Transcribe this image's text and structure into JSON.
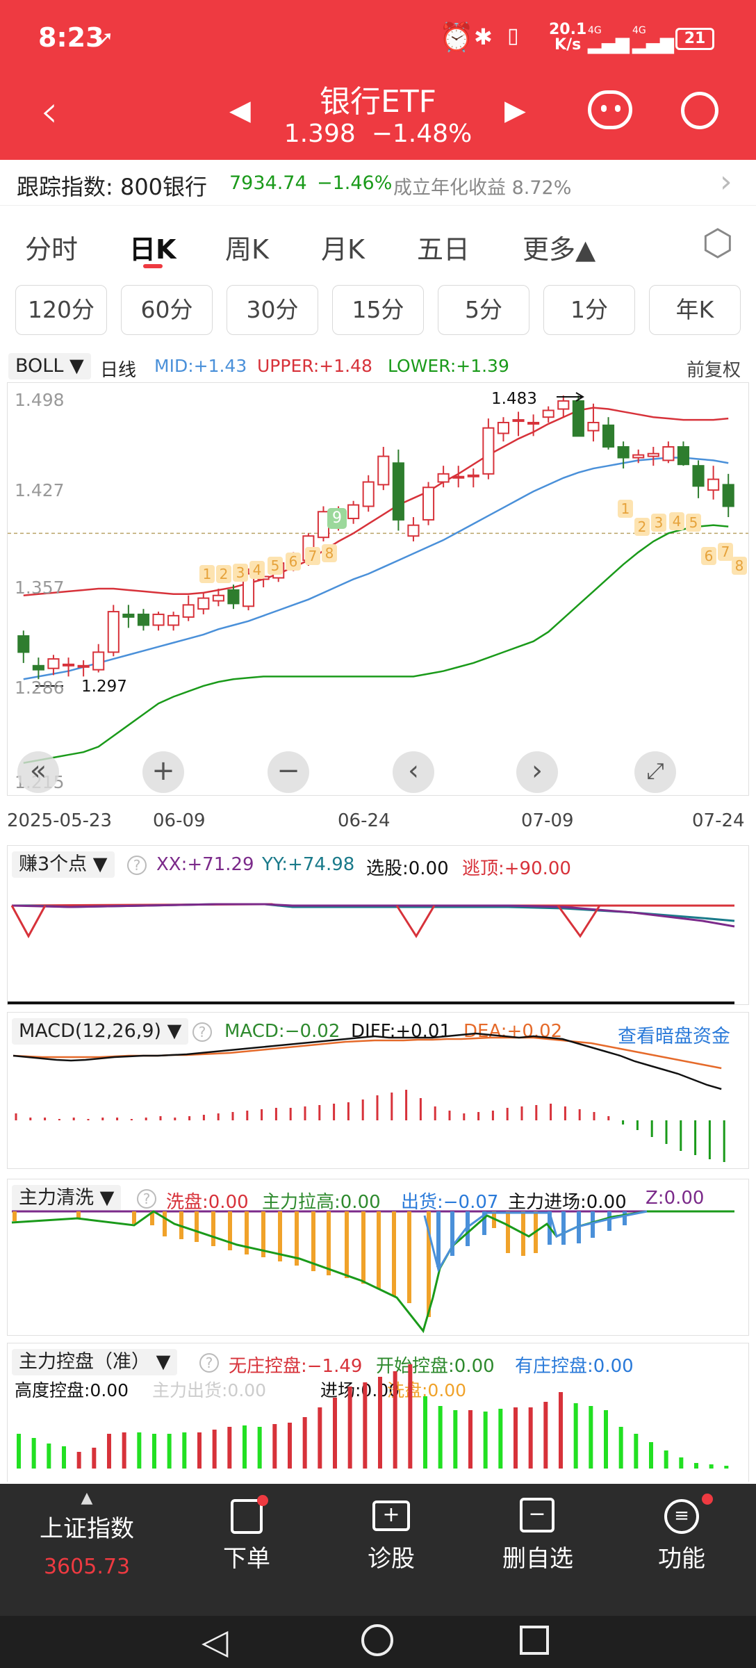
{
  "status_bar": {
    "time": "8:23",
    "net_speed_top": "20.1",
    "net_speed_unit": "K/s",
    "net_type_1": "4G",
    "net_type_2": "4G",
    "battery": "21"
  },
  "header": {
    "title": "银行ETF",
    "price": "1.398",
    "change": "−1.48%"
  },
  "tracker": {
    "label": "跟踪指数: 800银行",
    "index_value": "7934.74",
    "index_change": "−1.46%",
    "annual_return": "成立年化收益 8.72%"
  },
  "period_tabs": [
    "分时",
    "日K",
    "周K",
    "月K",
    "五日",
    "更多▲"
  ],
  "active_tab": "日K",
  "sub_periods": [
    "120分",
    "60分",
    "30分",
    "15分",
    "5分",
    "1分",
    "年K"
  ],
  "main_chart": {
    "indicator": "BOLL ▼",
    "line_type": "日线",
    "mid": "MID:+1.43",
    "upper": "UPPER:+1.48",
    "lower": "LOWER:+1.39",
    "adjust": "前复权",
    "y_ticks": [
      "1.498",
      "1.427",
      "1.357",
      "1.286",
      "1.215"
    ],
    "x_ticks": [
      "2025-05-23",
      "06-09",
      "06-24",
      "07-09",
      "07-24"
    ],
    "high_label": "1.483",
    "low_label": "1.297",
    "signal_9": "9"
  },
  "chart_data": {
    "type": "candlestick",
    "ylim": [
      1.215,
      1.498
    ],
    "candles": [
      {
        "o": 1.322,
        "h": 1.326,
        "l": 1.302,
        "c": 1.31
      },
      {
        "o": 1.3,
        "h": 1.306,
        "l": 1.29,
        "c": 1.297
      },
      {
        "o": 1.298,
        "h": 1.308,
        "l": 1.293,
        "c": 1.305
      },
      {
        "o": 1.3,
        "h": 1.306,
        "l": 1.292,
        "c": 1.301
      },
      {
        "o": 1.299,
        "h": 1.304,
        "l": 1.292,
        "c": 1.3
      },
      {
        "o": 1.297,
        "h": 1.316,
        "l": 1.295,
        "c": 1.31
      },
      {
        "o": 1.31,
        "h": 1.345,
        "l": 1.307,
        "c": 1.34
      },
      {
        "o": 1.338,
        "h": 1.345,
        "l": 1.328,
        "c": 1.336
      },
      {
        "o": 1.338,
        "h": 1.342,
        "l": 1.326,
        "c": 1.33
      },
      {
        "o": 1.33,
        "h": 1.34,
        "l": 1.326,
        "c": 1.338
      },
      {
        "o": 1.33,
        "h": 1.34,
        "l": 1.326,
        "c": 1.337
      },
      {
        "o": 1.336,
        "h": 1.352,
        "l": 1.333,
        "c": 1.345
      },
      {
        "o": 1.342,
        "h": 1.354,
        "l": 1.338,
        "c": 1.35
      },
      {
        "o": 1.348,
        "h": 1.357,
        "l": 1.344,
        "c": 1.352
      },
      {
        "o": 1.356,
        "h": 1.36,
        "l": 1.342,
        "c": 1.346
      },
      {
        "o": 1.344,
        "h": 1.372,
        "l": 1.341,
        "c": 1.368
      },
      {
        "o": 1.364,
        "h": 1.37,
        "l": 1.358,
        "c": 1.366
      },
      {
        "o": 1.365,
        "h": 1.378,
        "l": 1.362,
        "c": 1.376
      },
      {
        "o": 1.376,
        "h": 1.384,
        "l": 1.37,
        "c": 1.38
      },
      {
        "o": 1.378,
        "h": 1.398,
        "l": 1.374,
        "c": 1.396
      },
      {
        "o": 1.395,
        "h": 1.418,
        "l": 1.392,
        "c": 1.414
      },
      {
        "o": 1.405,
        "h": 1.418,
        "l": 1.4,
        "c": 1.413
      },
      {
        "o": 1.409,
        "h": 1.422,
        "l": 1.405,
        "c": 1.419
      },
      {
        "o": 1.418,
        "h": 1.441,
        "l": 1.414,
        "c": 1.436
      },
      {
        "o": 1.434,
        "h": 1.462,
        "l": 1.43,
        "c": 1.455
      },
      {
        "o": 1.45,
        "h": 1.46,
        "l": 1.4,
        "c": 1.408
      },
      {
        "o": 1.396,
        "h": 1.41,
        "l": 1.392,
        "c": 1.404
      },
      {
        "o": 1.408,
        "h": 1.436,
        "l": 1.404,
        "c": 1.432
      },
      {
        "o": 1.436,
        "h": 1.448,
        "l": 1.432,
        "c": 1.442
      },
      {
        "o": 1.44,
        "h": 1.448,
        "l": 1.432,
        "c": 1.44
      },
      {
        "o": 1.44,
        "h": 1.446,
        "l": 1.432,
        "c": 1.441
      },
      {
        "o": 1.442,
        "h": 1.483,
        "l": 1.438,
        "c": 1.476
      },
      {
        "o": 1.472,
        "h": 1.484,
        "l": 1.466,
        "c": 1.48
      },
      {
        "o": 1.481,
        "h": 1.488,
        "l": 1.47,
        "c": 1.482
      },
      {
        "o": 1.48,
        "h": 1.486,
        "l": 1.47,
        "c": 1.48
      },
      {
        "o": 1.484,
        "h": 1.492,
        "l": 1.48,
        "c": 1.489
      },
      {
        "o": 1.49,
        "h": 1.5,
        "l": 1.484,
        "c": 1.496
      },
      {
        "o": 1.496,
        "h": 1.5,
        "l": 1.47,
        "c": 1.47
      },
      {
        "o": 1.474,
        "h": 1.494,
        "l": 1.466,
        "c": 1.48
      },
      {
        "o": 1.478,
        "h": 1.484,
        "l": 1.46,
        "c": 1.462
      },
      {
        "o": 1.462,
        "h": 1.466,
        "l": 1.446,
        "c": 1.454
      },
      {
        "o": 1.454,
        "h": 1.46,
        "l": 1.45,
        "c": 1.456
      },
      {
        "o": 1.455,
        "h": 1.462,
        "l": 1.448,
        "c": 1.457
      },
      {
        "o": 1.452,
        "h": 1.466,
        "l": 1.45,
        "c": 1.462
      },
      {
        "o": 1.462,
        "h": 1.466,
        "l": 1.448,
        "c": 1.449
      },
      {
        "o": 1.448,
        "h": 1.452,
        "l": 1.424,
        "c": 1.433
      },
      {
        "o": 1.43,
        "h": 1.448,
        "l": 1.423,
        "c": 1.438
      },
      {
        "o": 1.434,
        "h": 1.442,
        "l": 1.41,
        "c": 1.418
      }
    ],
    "upper": [
      1.352,
      1.353,
      1.354,
      1.355,
      1.356,
      1.357,
      1.357,
      1.356,
      1.355,
      1.354,
      1.353,
      1.353,
      1.354,
      1.356,
      1.358,
      1.361,
      1.364,
      1.368,
      1.373,
      1.378,
      1.385,
      1.392,
      1.398,
      1.405,
      1.412,
      1.419,
      1.424,
      1.429,
      1.436,
      1.442,
      1.449,
      1.456,
      1.462,
      1.468,
      1.473,
      1.479,
      1.484,
      1.489,
      1.491,
      1.49,
      1.488,
      1.486,
      1.484,
      1.483,
      1.482,
      1.482,
      1.482,
      1.483
    ],
    "mid": [
      1.29,
      1.292,
      1.294,
      1.296,
      1.299,
      1.302,
      1.305,
      1.308,
      1.311,
      1.314,
      1.317,
      1.32,
      1.323,
      1.327,
      1.33,
      1.333,
      1.337,
      1.341,
      1.345,
      1.349,
      1.354,
      1.359,
      1.364,
      1.368,
      1.373,
      1.378,
      1.383,
      1.388,
      1.393,
      1.399,
      1.405,
      1.411,
      1.417,
      1.423,
      1.429,
      1.434,
      1.439,
      1.443,
      1.446,
      1.448,
      1.45,
      1.452,
      1.453,
      1.454,
      1.454,
      1.453,
      1.452,
      1.45
    ],
    "lower": [
      1.228,
      1.23,
      1.232,
      1.234,
      1.236,
      1.24,
      1.248,
      1.256,
      1.264,
      1.272,
      1.277,
      1.281,
      1.285,
      1.288,
      1.29,
      1.291,
      1.292,
      1.292,
      1.292,
      1.292,
      1.292,
      1.292,
      1.292,
      1.292,
      1.292,
      1.292,
      1.292,
      1.294,
      1.296,
      1.299,
      1.302,
      1.306,
      1.31,
      1.314,
      1.318,
      1.325,
      1.335,
      1.345,
      1.355,
      1.365,
      1.375,
      1.384,
      1.392,
      1.398,
      1.401,
      1.403,
      1.404,
      1.403
    ],
    "reference_price": 1.398
  },
  "panel_earn": {
    "name": "赚3个点 ▼",
    "xx": "XX:+71.29",
    "yy": "YY:+74.98",
    "pick": "选股:0.00",
    "escape": "逃顶:+90.00"
  },
  "panel_macd": {
    "name": "MACD(12,26,9) ▼",
    "macd": "MACD:−0.02",
    "diff": "DIFF:+0.01",
    "dea": "DEA:+0.02",
    "link": "查看暗盘资金"
  },
  "panel_wash": {
    "name": "主力清洗 ▼",
    "wash": "洗盘:0.00",
    "lift": "主力拉高:0.00",
    "out": "出货:−0.07",
    "enter": "主力进场:0.00",
    "z": "Z:0.00"
  },
  "panel_control": {
    "name": "主力控盘（准） ▼",
    "none": "无庄控盘:−1.49",
    "start": "开始控盘:0.00",
    "has": "有庄控盘:0.00",
    "high": "高度控盘:0.00",
    "ship": "主力出货:0.00",
    "enter": "进场:0.00",
    "wash": "洗盘:0.00"
  },
  "bottom_nav": {
    "index_name": "上证指数",
    "index_value": "3605.73",
    "items": [
      "下单",
      "诊股",
      "删自选",
      "功能"
    ]
  },
  "colors": {
    "brand": "#ee3a41",
    "up": "#d7323a",
    "down": "#2e7d2e",
    "mid_line": "#4a90d9",
    "lower_line": "#1a9a1a"
  }
}
